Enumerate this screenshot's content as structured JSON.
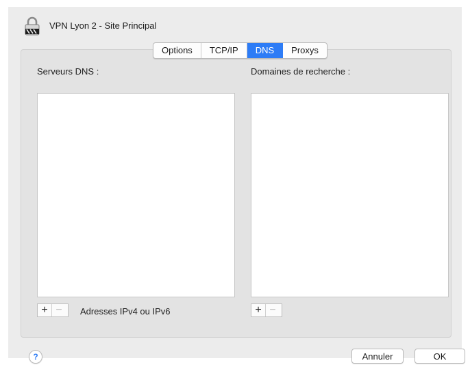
{
  "window": {
    "title": "VPN Lyon 2 - Site Principal"
  },
  "tabs": [
    {
      "label": "Options",
      "active": false
    },
    {
      "label": "TCP/IP",
      "active": false
    },
    {
      "label": "DNS",
      "active": true
    },
    {
      "label": "Proxys",
      "active": false
    }
  ],
  "dns": {
    "servers_label": "Serveurs DNS :",
    "servers_hint": "Adresses IPv4 ou IPv6",
    "search_label": "Domaines de recherche :"
  },
  "controls": {
    "add": "+",
    "remove": "−"
  },
  "footer": {
    "help": "?",
    "cancel": "Annuler",
    "ok": "OK"
  },
  "colors": {
    "accent": "#2d7cf6"
  },
  "icons": {
    "vpn": "padlock-network-icon"
  }
}
